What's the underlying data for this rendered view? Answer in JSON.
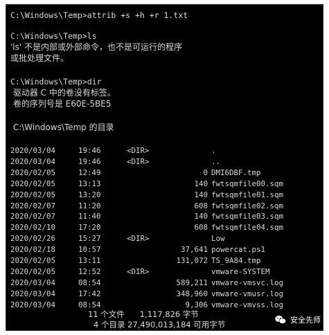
{
  "console": {
    "cmd_attrib": "C:\\Windows\\Temp>attrib +s +h +r 1.txt",
    "cmd_ls": "C:\\Windows\\Temp>ls",
    "err_line1": "'ls' 不是内部或外部命令，也不是可运行的程序",
    "err_line2": "或批处理文件。",
    "cmd_dir": "C:\\Windows\\Temp>dir",
    "volume_label": " 驱动器 C 中的卷没有标签。",
    "volume_serial": " 卷的序列号是 E60E-5BE5",
    "dir_header": " C:\\Windows\\Temp 的目录",
    "entries": [
      {
        "date": "2020/03/04",
        "time": "19:46",
        "tag": "<DIR>",
        "size": "",
        "name": "."
      },
      {
        "date": "2020/03/04",
        "time": "19:46",
        "tag": "<DIR>",
        "size": "",
        "name": ".."
      },
      {
        "date": "2020/02/05",
        "time": "12:49",
        "tag": "",
        "size": "0",
        "name": "DMI6DBF.tmp"
      },
      {
        "date": "2020/02/05",
        "time": "13:13",
        "tag": "",
        "size": "140",
        "name": "fwtsqmfile00.sqm"
      },
      {
        "date": "2020/02/05",
        "time": "13:20",
        "tag": "",
        "size": "140",
        "name": "fwtsqmfile01.sqm"
      },
      {
        "date": "2020/02/07",
        "time": "11:20",
        "tag": "",
        "size": "608",
        "name": "fwtsqmfile02.sqm"
      },
      {
        "date": "2020/02/07",
        "time": "11:40",
        "tag": "",
        "size": "140",
        "name": "fwtsqmfile03.sqm"
      },
      {
        "date": "2020/02/10",
        "time": "17:20",
        "tag": "",
        "size": "608",
        "name": "fwtsqmfile04.sqm"
      },
      {
        "date": "2020/02/26",
        "time": "15:27",
        "tag": "<DIR>",
        "size": "",
        "name": "Low"
      },
      {
        "date": "2020/02/18",
        "time": "10:57",
        "tag": "",
        "size": "37,641",
        "name": "powercat.ps1"
      },
      {
        "date": "2020/02/05",
        "time": "13:11",
        "tag": "",
        "size": "131,072",
        "name": "TS_9A84.tmp"
      },
      {
        "date": "2020/02/05",
        "time": "12:52",
        "tag": "<DIR>",
        "size": "",
        "name": "vmware-SYSTEM"
      },
      {
        "date": "2020/03/04",
        "time": "08:54",
        "tag": "",
        "size": "589,211",
        "name": "vmware-vmsvc.log"
      },
      {
        "date": "2020/03/04",
        "time": "17:42",
        "tag": "",
        "size": "348,960",
        "name": "vmware-vmusr.log"
      },
      {
        "date": "2020/03/04",
        "time": "08:54",
        "tag": "",
        "size": "9,306",
        "name": "vmware-vmvss.log"
      }
    ],
    "summary_files": "11 个文件      1,117,826 字节",
    "summary_dirs": "4 个目录 27,490,013,184 可用字节"
  },
  "watermark": {
    "text": "安全先师",
    "icon": "wechat-icon"
  },
  "colors": {
    "background": "#000000",
    "text": "#d8d8d8",
    "page": "#ffffff"
  }
}
